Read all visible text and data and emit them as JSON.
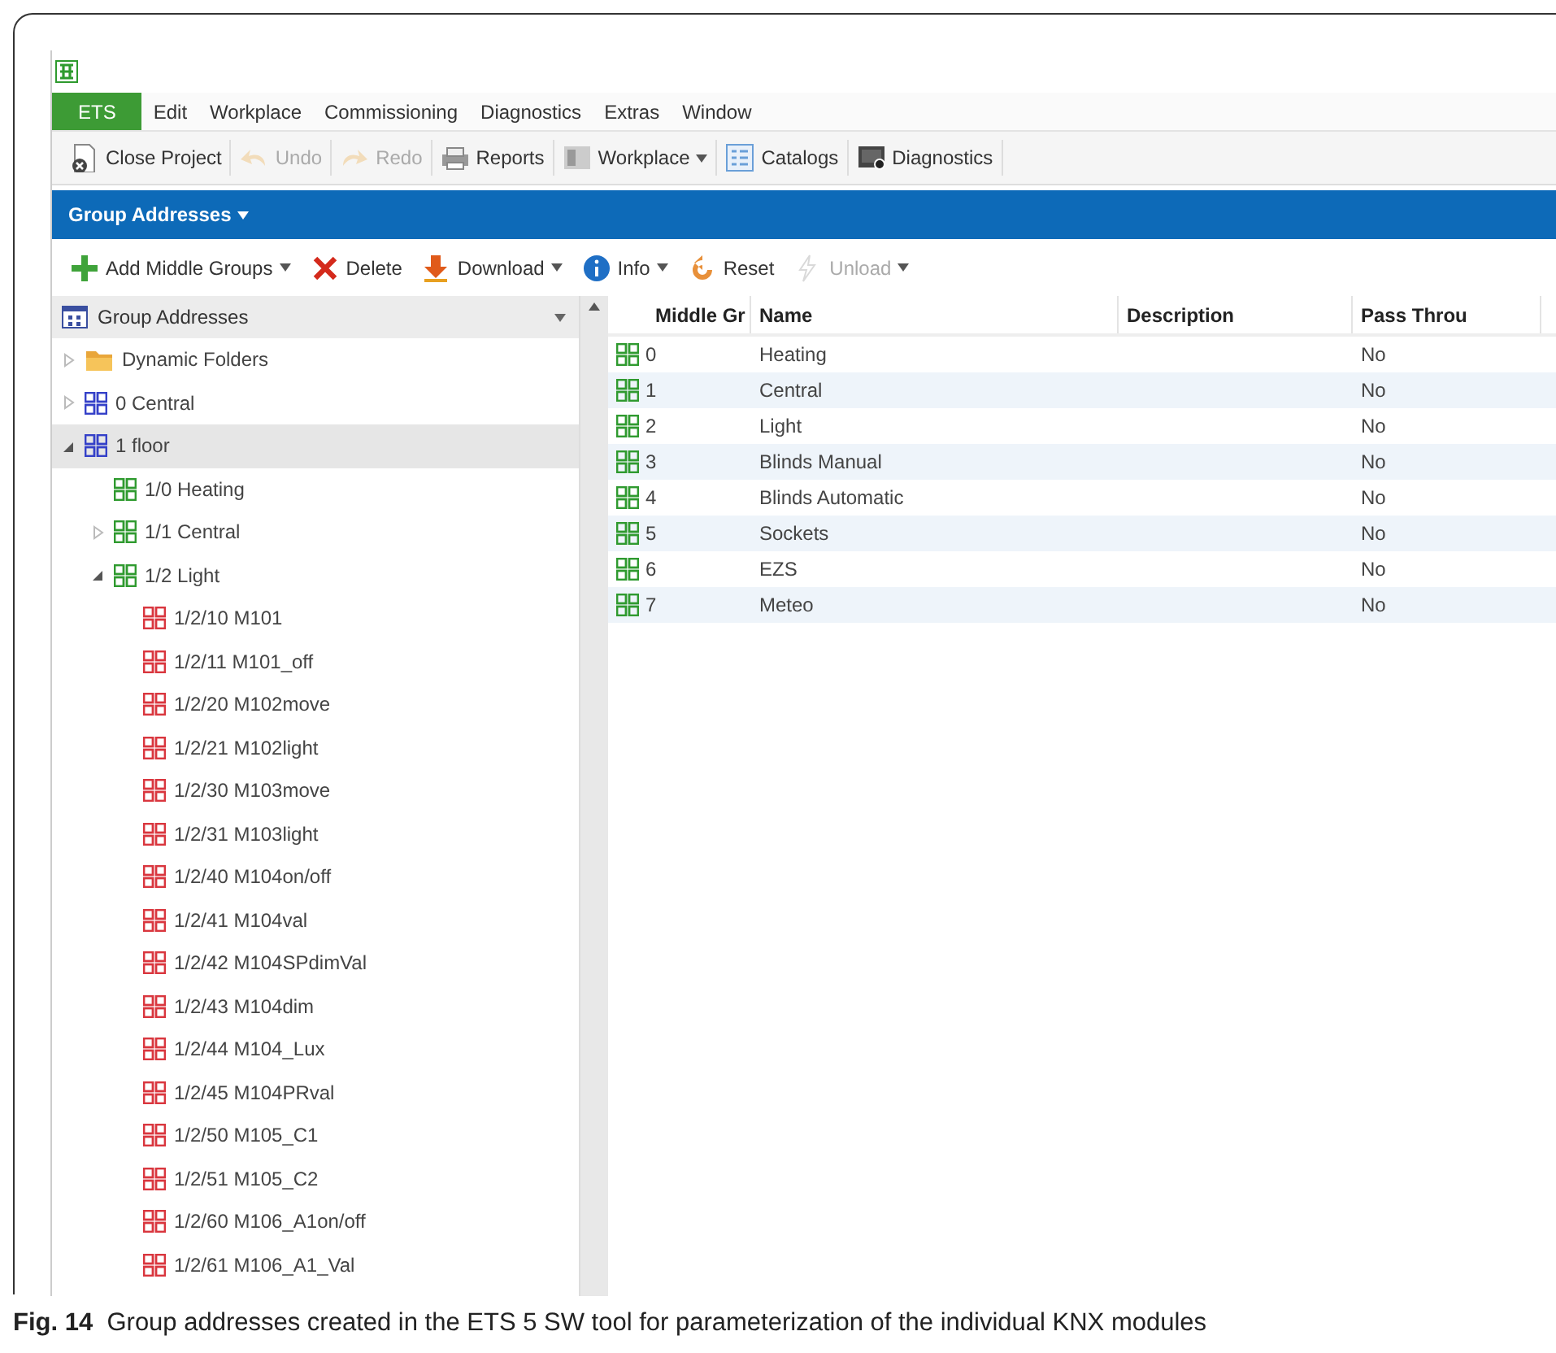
{
  "menu": [
    {
      "label": "ETS",
      "selected": true
    },
    {
      "label": "Edit",
      "selected": false
    },
    {
      "label": "Workplace",
      "selected": false
    },
    {
      "label": "Commissioning",
      "selected": false
    },
    {
      "label": "Diagnostics",
      "selected": false
    },
    {
      "label": "Extras",
      "selected": false
    },
    {
      "label": "Window",
      "selected": false
    }
  ],
  "toolbar": [
    {
      "kind": "close",
      "label": "Close Project",
      "disabled": false,
      "dropdown": false
    },
    {
      "kind": "undo",
      "label": "Undo",
      "disabled": true,
      "dropdown": false
    },
    {
      "kind": "redo",
      "label": "Redo",
      "disabled": true,
      "dropdown": false
    },
    {
      "kind": "reports",
      "label": "Reports",
      "disabled": false,
      "dropdown": false
    },
    {
      "kind": "workplace",
      "label": "Workplace",
      "disabled": false,
      "dropdown": true
    },
    {
      "kind": "catalogs",
      "label": "Catalogs",
      "disabled": false,
      "dropdown": false
    },
    {
      "kind": "diagnostics",
      "label": "Diagnostics",
      "disabled": false,
      "dropdown": false
    }
  ],
  "panel_title": "Group Addresses",
  "actions": [
    {
      "kind": "add",
      "label": "Add Middle Groups",
      "disabled": false,
      "dropdown": true
    },
    {
      "kind": "delete",
      "label": "Delete",
      "disabled": false,
      "dropdown": false
    },
    {
      "kind": "download",
      "label": "Download",
      "disabled": false,
      "dropdown": true
    },
    {
      "kind": "info",
      "label": "Info",
      "disabled": false,
      "dropdown": true
    },
    {
      "kind": "reset",
      "label": "Reset",
      "disabled": false,
      "dropdown": false
    },
    {
      "kind": "unload",
      "label": "Unload",
      "disabled": true,
      "dropdown": true
    }
  ],
  "tree": {
    "title": "Group Addresses",
    "items": [
      {
        "kind": "folder",
        "label": "Dynamic Folders",
        "expanded": false,
        "selected": false
      },
      {
        "kind": "main",
        "label": "0 Central",
        "expanded": false,
        "selected": false
      },
      {
        "kind": "main",
        "label": "1 floor",
        "expanded": true,
        "selected": true,
        "children": [
          {
            "kind": "middle",
            "label": "1/0 Heating",
            "selected": false
          },
          {
            "kind": "middle",
            "label": "1/1 Central",
            "expanded": false,
            "selected": false
          },
          {
            "kind": "middle",
            "label": "1/2 Light",
            "expanded": true,
            "selected": false,
            "children": [
              {
                "kind": "address",
                "label": "1/2/10 M101",
                "selected": false
              },
              {
                "kind": "address",
                "label": "1/2/11 M101_off",
                "selected": false
              },
              {
                "kind": "address",
                "label": "1/2/20 M102move",
                "selected": false
              },
              {
                "kind": "address",
                "label": "1/2/21 M102light",
                "selected": false
              },
              {
                "kind": "address",
                "label": "1/2/30 M103move",
                "selected": false
              },
              {
                "kind": "address",
                "label": "1/2/31 M103light",
                "selected": false
              },
              {
                "kind": "address",
                "label": "1/2/40 M104on/off",
                "selected": false
              },
              {
                "kind": "address",
                "label": "1/2/41 M104val",
                "selected": false
              },
              {
                "kind": "address",
                "label": "1/2/42 M104SPdimVal",
                "selected": false
              },
              {
                "kind": "address",
                "label": "1/2/43 M104dim",
                "selected": false
              },
              {
                "kind": "address",
                "label": "1/2/44 M104_Lux",
                "selected": false
              },
              {
                "kind": "address",
                "label": "1/2/45 M104PRval",
                "selected": false
              },
              {
                "kind": "address",
                "label": "1/2/50 M105_C1",
                "selected": false
              },
              {
                "kind": "address",
                "label": "1/2/51 M105_C2",
                "selected": false
              },
              {
                "kind": "address",
                "label": "1/2/60 M106_A1on/off",
                "selected": false
              },
              {
                "kind": "address",
                "label": "1/2/61 M106_A1_Val",
                "selected": false
              }
            ]
          }
        ]
      }
    ]
  },
  "table": {
    "columns": [
      "Middle Gr",
      "Name",
      "Description",
      "Pass Throu"
    ],
    "rows": [
      {
        "middle_group": "0",
        "name": "Heating",
        "pass_through": "No"
      },
      {
        "middle_group": "1",
        "name": "Central",
        "pass_through": "No"
      },
      {
        "middle_group": "2",
        "name": "Light",
        "pass_through": "No"
      },
      {
        "middle_group": "3",
        "name": "Blinds Manual",
        "pass_through": "No"
      },
      {
        "middle_group": "4",
        "name": "Blinds Automatic",
        "pass_through": "No"
      },
      {
        "middle_group": "5",
        "name": "Sockets",
        "pass_through": "No"
      },
      {
        "middle_group": "6",
        "name": "EZS",
        "pass_through": "No"
      },
      {
        "middle_group": "7",
        "name": "Meteo",
        "pass_through": "No"
      }
    ]
  },
  "caption": {
    "label": "Fig. 14",
    "text": "Group addresses created in the ETS 5 SW tool for parameterization of the individual KNX modules"
  }
}
